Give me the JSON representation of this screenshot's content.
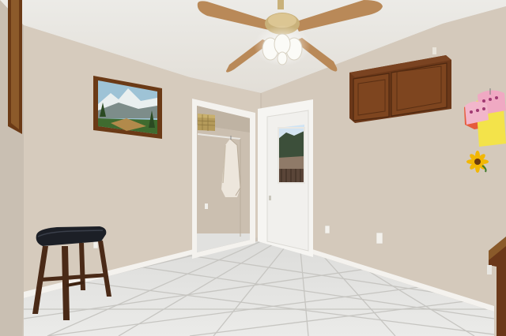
{
  "scene": {
    "palette": {
      "ceiling": "#e9e6e0",
      "wall_left": "#d6cbbd",
      "wall_back": "#d2c7b9",
      "wall_right": "#d4c9bb",
      "trim": "#f4f2ee",
      "floor_tile": "#e4e4e2",
      "grout": "#c9c8c4",
      "wood": "#6b3819",
      "wood_light": "#8a4a22",
      "fan_blade": "#b98958",
      "stool_seat": "#1c1f26",
      "stool_wood": "#4a2a17"
    },
    "objects": [
      "ceiling-fan",
      "framed-painting",
      "open-closet",
      "hanging-coat",
      "storage-basket",
      "exterior-door",
      "wall-cabinet",
      "oven-mitts",
      "sunflower-decor",
      "bar-stool",
      "tile-floor",
      "wall-outlets"
    ]
  }
}
